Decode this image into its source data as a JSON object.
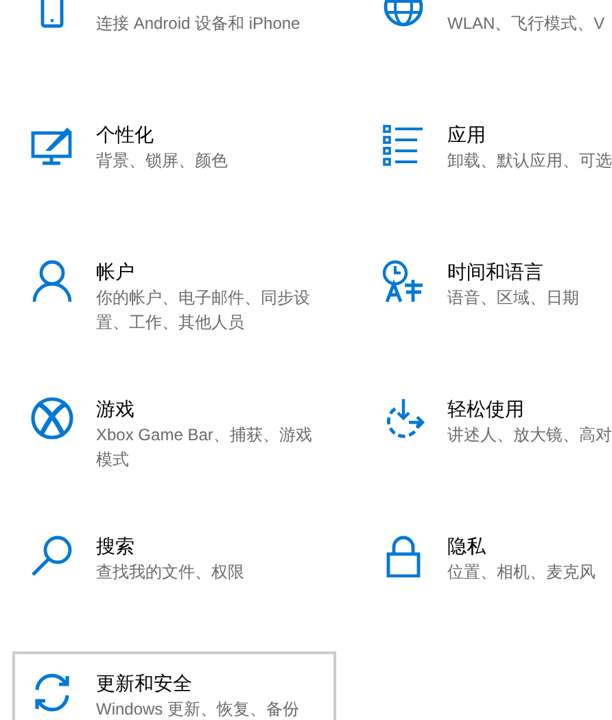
{
  "tiles": [
    {
      "description": "连接 Android 设备和 iPhone",
      "hovered": false
    },
    {
      "description": "WLAN、飞行模式、V",
      "hovered": false
    },
    {
      "title": "个性化",
      "description": "背景、锁屏、颜色",
      "hovered": false
    },
    {
      "title": "应用",
      "description": "卸载、默认应用、可选",
      "hovered": false
    },
    {
      "title": "帐户",
      "description": "你的帐户、电子邮件、同步设置、工作、其他人员",
      "hovered": false
    },
    {
      "title": "时间和语言",
      "description": "语音、区域、日期",
      "hovered": false
    },
    {
      "title": "游戏",
      "description": "Xbox Game Bar、捕获、游戏模式",
      "hovered": false
    },
    {
      "title": "轻松使用",
      "description": "讲述人、放大镜、高对",
      "hovered": false
    },
    {
      "title": "搜索",
      "description": "查找我的文件、权限",
      "hovered": false
    },
    {
      "title": "隐私",
      "description": "位置、相机、麦克风",
      "hovered": false
    },
    {
      "title": "更新和安全",
      "description": "Windows 更新、恢复、备份",
      "hovered": true
    }
  ]
}
